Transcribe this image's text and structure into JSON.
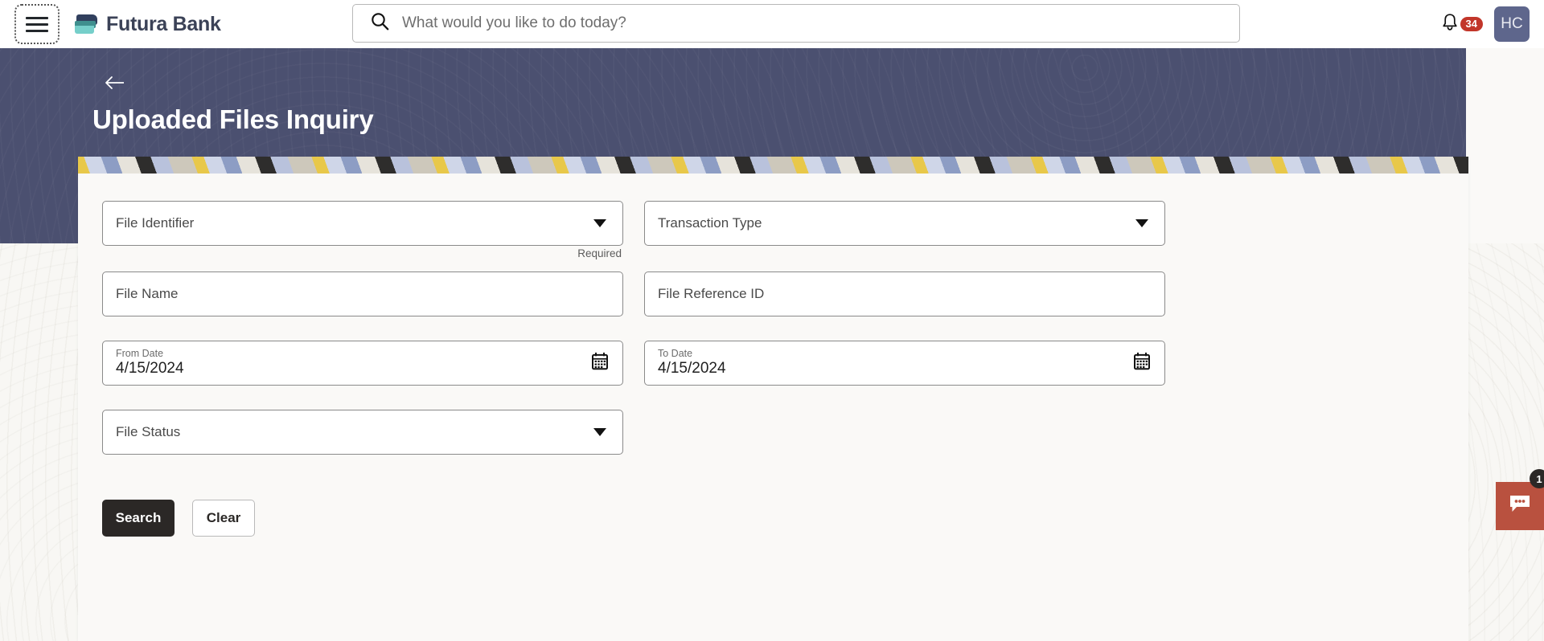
{
  "header": {
    "menu_icon": "hamburger-menu-icon",
    "brand_name": "Futura Bank",
    "brand_logo_icon": "futura-bank-card-logo",
    "search": {
      "icon": "search-icon",
      "placeholder": "What would you like to do today?",
      "value": ""
    },
    "notifications": {
      "icon": "bell-icon",
      "count": "34",
      "badge_color": "#c2362a"
    },
    "avatar": {
      "initials": "HC",
      "color": "#5e668c"
    }
  },
  "banner": {
    "back_icon": "back-arrow-icon",
    "title": "Uploaded Files Inquiry",
    "background_color": "#4b5070"
  },
  "form": {
    "fields": {
      "file_identifier": {
        "label": "File Identifier",
        "value": "",
        "type": "select",
        "caret_icon": "chevron-down-icon",
        "helper_text": "Required"
      },
      "transaction_type": {
        "label": "Transaction Type",
        "value": "",
        "type": "select",
        "caret_icon": "chevron-down-icon"
      },
      "file_name": {
        "label": "File Name",
        "value": "",
        "type": "text"
      },
      "file_reference_id": {
        "label": "File Reference ID",
        "value": "",
        "type": "text"
      },
      "from_date": {
        "label": "From Date",
        "value": "4/15/2024",
        "type": "date",
        "calendar_icon": "calendar-icon"
      },
      "to_date": {
        "label": "To Date",
        "value": "4/15/2024",
        "type": "date",
        "calendar_icon": "calendar-icon"
      },
      "file_status": {
        "label": "File Status",
        "value": "",
        "type": "select",
        "caret_icon": "chevron-down-icon"
      }
    },
    "buttons": {
      "search": "Search",
      "clear": "Clear"
    }
  },
  "chat_widget": {
    "icon": "chat-bubble-icon",
    "badge_count": "1",
    "color": "#b9513f"
  }
}
